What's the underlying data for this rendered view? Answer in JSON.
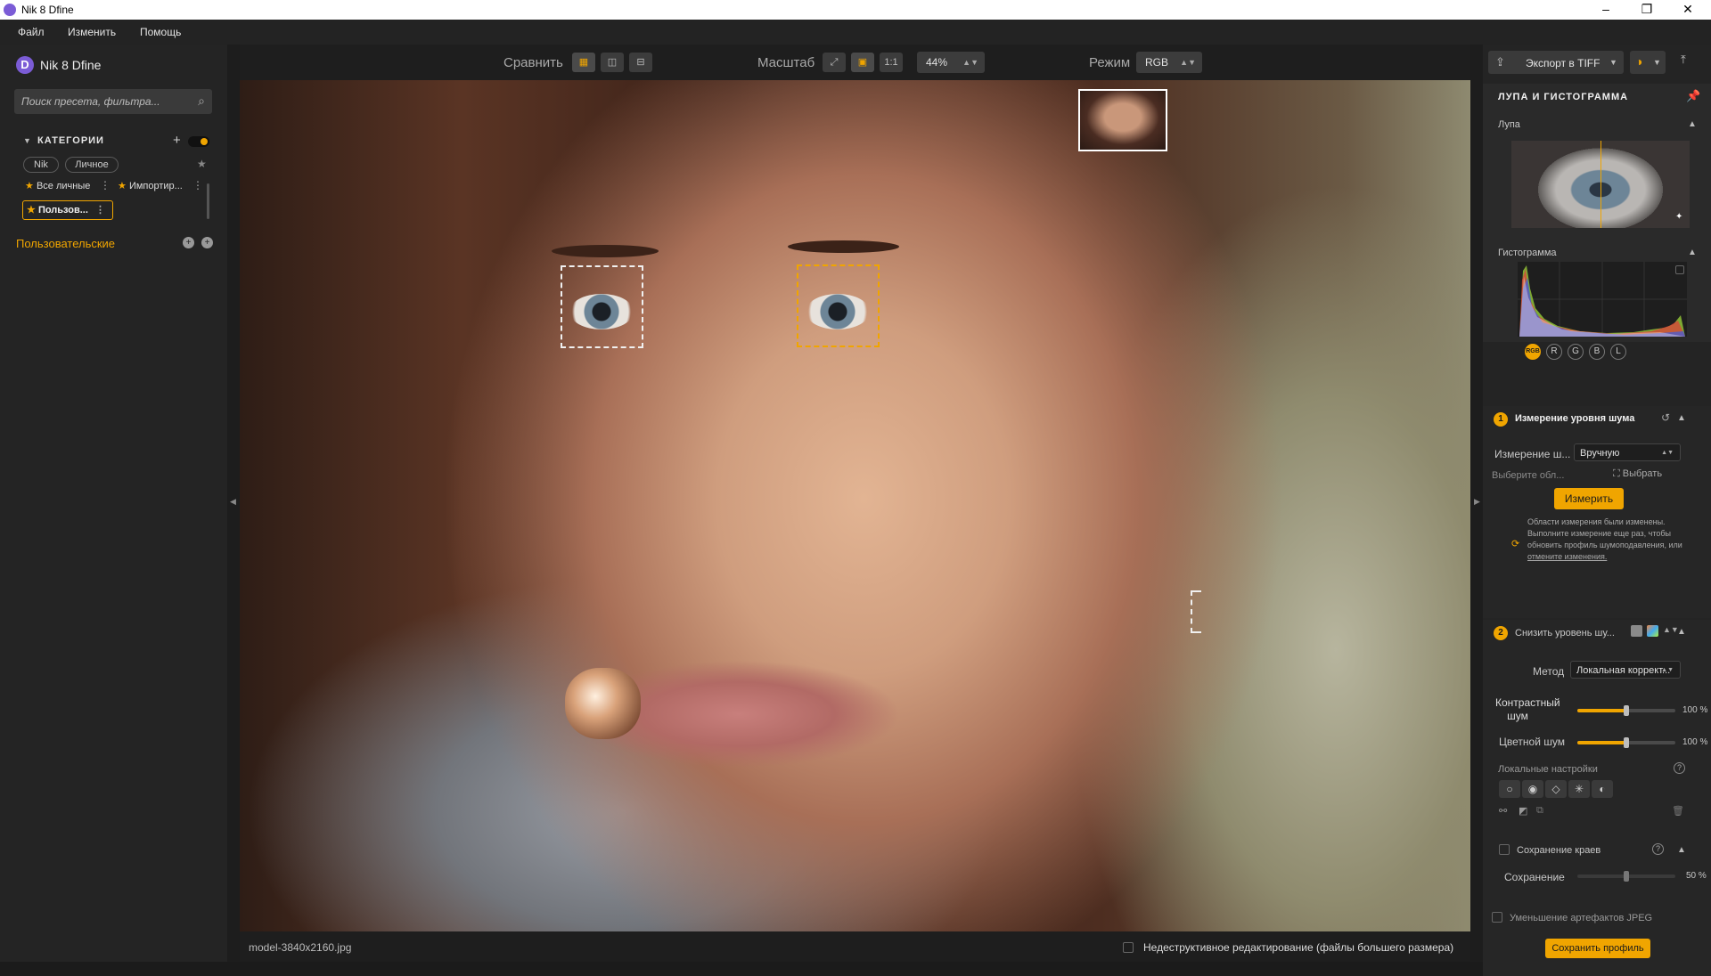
{
  "window": {
    "title": "Nik 8 Dfine",
    "minimize": "–",
    "maximize": "❐",
    "close": "✕"
  },
  "menu": [
    "Файл",
    "Изменить",
    "Помощь"
  ],
  "left": {
    "app_name": "Nik 8 Dfine",
    "search_placeholder": "Поиск пресета, фильтра...",
    "categories_title": "КАТЕГОРИИ",
    "tabs": [
      "Nik",
      "Личное"
    ],
    "presets": [
      "Все личные",
      "Импортир...",
      "Пользов..."
    ],
    "custom_label": "Пользовательские"
  },
  "toolbar": {
    "compare_label": "Сравнить",
    "zoom_label": "Масштаб",
    "zoom_one_to_one": "1:1",
    "zoom_value": "44%",
    "mode_label": "Режим",
    "mode_value": "RGB"
  },
  "status": {
    "filename": "model-3840x2160.jpg",
    "nondestructive": "Недеструктивное редактирование (файлы большего размера)"
  },
  "right": {
    "export_label": "Экспорт в TIFF",
    "loupe_title": "ЛУПА И ГИСТОГРАММА",
    "loupe_label": "Лупа",
    "histogram_label": "Гистограмма",
    "histogram_channels": [
      "RGB",
      "R",
      "G",
      "B",
      "L"
    ],
    "step1": {
      "num": "1",
      "title": "Измерение уровня шума",
      "method_label": "Измерение ш...",
      "method_value": "Вручную",
      "select_hint": "Выберите обл...",
      "select_button": "Выбрать",
      "measure_button": "Измерить",
      "notice": "Области измерения были изменены. Выполните измерение еще раз, чтобы обновить профиль шумоподавления, или",
      "notice_link": "отмените изменения."
    },
    "step2": {
      "num": "2",
      "title": "Снизить уровень шу...",
      "method_label": "Метод",
      "method_value": "Локальная коррект...",
      "contrast_noise_label_1": "Контрастный",
      "contrast_noise_label_2": "шум",
      "contrast_noise_value": "100 %",
      "color_noise_label": "Цветной шум",
      "color_noise_value": "100 %",
      "local_settings": "Локальные настройки",
      "edge_label": "Сохранение краев",
      "edge_sub_label": "Сохранение",
      "edge_value": "50 %",
      "jpeg_label": "Уменьшение артефактов JPEG"
    },
    "save_profile": "Сохранить профиль"
  },
  "colors": {
    "accent": "#f0a500",
    "panel": "#242424",
    "bg": "#1b1b1b"
  }
}
